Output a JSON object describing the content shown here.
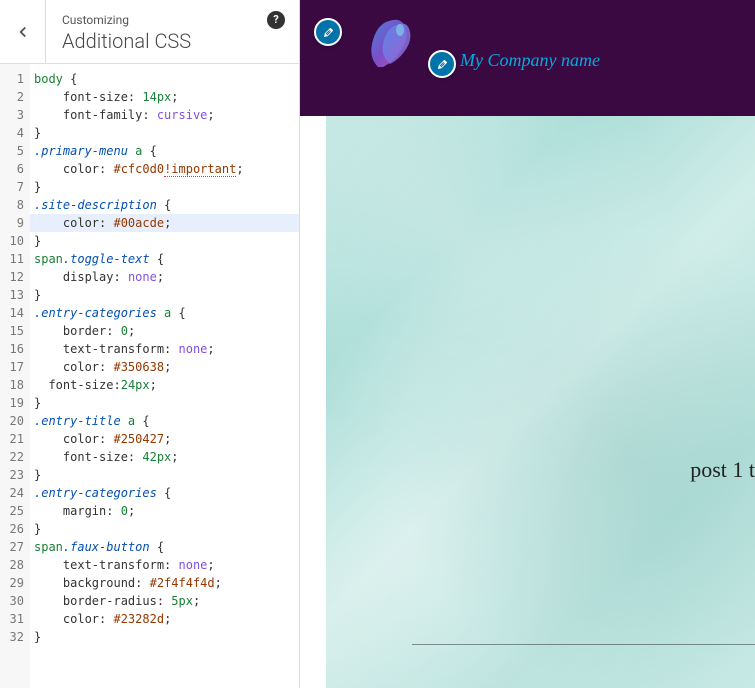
{
  "panel": {
    "subtitle": "Customizing",
    "title": "Additional CSS"
  },
  "code": {
    "active_line": 9,
    "lines": [
      [
        [
          "tag",
          "body"
        ],
        [
          "punc",
          " {"
        ]
      ],
      [
        [
          "prop",
          "    font-size"
        ],
        [
          "punc",
          ": "
        ],
        [
          "num",
          "14px"
        ],
        [
          "punc",
          ";"
        ]
      ],
      [
        [
          "prop",
          "    font-family"
        ],
        [
          "punc",
          ": "
        ],
        [
          "key",
          "cursive"
        ],
        [
          "punc",
          ";"
        ]
      ],
      [
        [
          "punc",
          "}"
        ]
      ],
      [
        [
          "class",
          ".primary-menu"
        ],
        [
          "tag",
          " a"
        ],
        [
          "punc",
          " {"
        ]
      ],
      [
        [
          "prop",
          "    color"
        ],
        [
          "punc",
          ": "
        ],
        [
          "str",
          "#cfc0d0"
        ],
        [
          "imp",
          "!important"
        ],
        [
          "punc",
          ";"
        ]
      ],
      [
        [
          "punc",
          "}"
        ]
      ],
      [
        [
          "class",
          ".site-description"
        ],
        [
          "punc",
          " {"
        ]
      ],
      [
        [
          "prop",
          "    color"
        ],
        [
          "punc",
          ": "
        ],
        [
          "str",
          "#00acde"
        ],
        [
          "punc",
          ";"
        ]
      ],
      [
        [
          "punc",
          "}"
        ]
      ],
      [
        [
          "tag",
          "span"
        ],
        [
          "class",
          ".toggle-text"
        ],
        [
          "punc",
          " {"
        ]
      ],
      [
        [
          "prop",
          "    display"
        ],
        [
          "punc",
          ": "
        ],
        [
          "key",
          "none"
        ],
        [
          "punc",
          ";"
        ]
      ],
      [
        [
          "punc",
          "}"
        ]
      ],
      [
        [
          "class",
          ".entry-categories"
        ],
        [
          "tag",
          " a"
        ],
        [
          "punc",
          " {"
        ]
      ],
      [
        [
          "prop",
          "    border"
        ],
        [
          "punc",
          ": "
        ],
        [
          "num",
          "0"
        ],
        [
          "punc",
          ";"
        ]
      ],
      [
        [
          "prop",
          "    text-transform"
        ],
        [
          "punc",
          ": "
        ],
        [
          "key",
          "none"
        ],
        [
          "punc",
          ";"
        ]
      ],
      [
        [
          "prop",
          "    color"
        ],
        [
          "punc",
          ": "
        ],
        [
          "str",
          "#350638"
        ],
        [
          "punc",
          ";"
        ]
      ],
      [
        [
          "prop",
          "  font-size"
        ],
        [
          "punc",
          ":"
        ],
        [
          "num",
          "24px"
        ],
        [
          "punc",
          ";"
        ]
      ],
      [
        [
          "punc",
          "}"
        ]
      ],
      [
        [
          "class",
          ".entry-title"
        ],
        [
          "tag",
          " a"
        ],
        [
          "punc",
          " {"
        ]
      ],
      [
        [
          "prop",
          "    color"
        ],
        [
          "punc",
          ": "
        ],
        [
          "str",
          "#250427"
        ],
        [
          "punc",
          ";"
        ]
      ],
      [
        [
          "prop",
          "    font-size"
        ],
        [
          "punc",
          ": "
        ],
        [
          "num",
          "42px"
        ],
        [
          "punc",
          ";"
        ]
      ],
      [
        [
          "punc",
          "}"
        ]
      ],
      [
        [
          "class",
          ".entry-categories"
        ],
        [
          "punc",
          " {"
        ]
      ],
      [
        [
          "prop",
          "    margin"
        ],
        [
          "punc",
          ": "
        ],
        [
          "num",
          "0"
        ],
        [
          "punc",
          ";"
        ]
      ],
      [
        [
          "punc",
          "}"
        ]
      ],
      [
        [
          "tag",
          "span"
        ],
        [
          "class",
          ".faux-button"
        ],
        [
          "punc",
          " {"
        ]
      ],
      [
        [
          "prop",
          "    text-transform"
        ],
        [
          "punc",
          ": "
        ],
        [
          "key",
          "none"
        ],
        [
          "punc",
          ";"
        ]
      ],
      [
        [
          "prop",
          "    background"
        ],
        [
          "punc",
          ": "
        ],
        [
          "str",
          "#2f4f4f4d"
        ],
        [
          "punc",
          ";"
        ]
      ],
      [
        [
          "prop",
          "    border-radius"
        ],
        [
          "punc",
          ": "
        ],
        [
          "num",
          "5px"
        ],
        [
          "punc",
          ";"
        ]
      ],
      [
        [
          "prop",
          "    color"
        ],
        [
          "punc",
          ": "
        ],
        [
          "str",
          "#23282d"
        ],
        [
          "punc",
          ";"
        ]
      ],
      [
        [
          "punc",
          "}"
        ]
      ]
    ]
  },
  "preview": {
    "site_name": "My Company name",
    "post_title": "post 1 t"
  }
}
